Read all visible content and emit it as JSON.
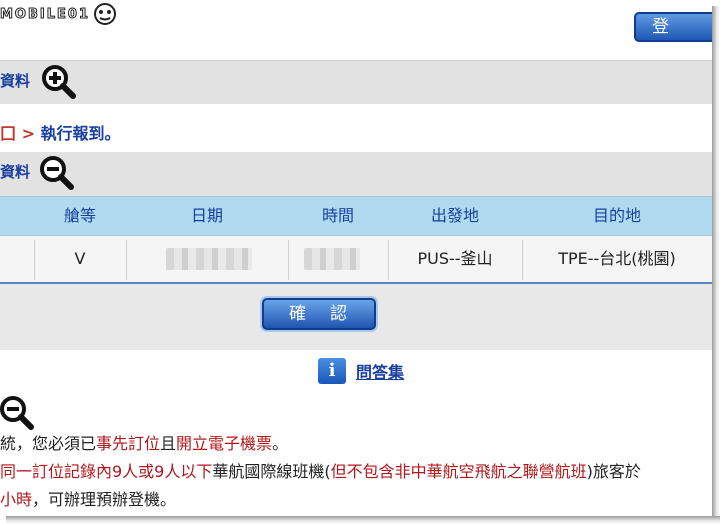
{
  "header": {
    "logo_text": "MOBILE01",
    "login_label": "登"
  },
  "section1": {
    "label": "資料",
    "icon": "zoom-in-icon"
  },
  "instruction": {
    "arrow": "囗 >",
    "text": " 執行報到。"
  },
  "section2": {
    "label": "資料",
    "icon": "zoom-out-icon"
  },
  "table": {
    "headers": [
      "艙等",
      "日期",
      "時間",
      "出發地",
      "目的地"
    ],
    "row": {
      "cabin": "V",
      "date": "",
      "time": "",
      "origin": "PUS--釜山",
      "destination": "TPE--台北(桃園)"
    }
  },
  "confirm": {
    "label": "確認"
  },
  "faq": {
    "icon_char": "i",
    "label": "問答集"
  },
  "notes": {
    "line1": [
      {
        "text": "統，您必須已",
        "style": "normal"
      },
      {
        "text": "事先訂位",
        "style": "red"
      },
      {
        "text": "且",
        "style": "normal"
      },
      {
        "text": "開立電子機票",
        "style": "red"
      },
      {
        "text": "。",
        "style": "normal"
      }
    ],
    "line2": [
      {
        "text": "同一訂位記錄內9人或9人以下",
        "style": "red"
      },
      {
        "text": "華航國際線班機(",
        "style": "normal"
      },
      {
        "text": "但不包含非中華航空飛航之聯營航班",
        "style": "red"
      },
      {
        "text": ")旅客於",
        "style": "normal"
      }
    ],
    "line3": [
      {
        "text": "小時",
        "style": "red"
      },
      {
        "text": "，可辦理預辦登機。",
        "style": "normal"
      }
    ]
  },
  "colors": {
    "header_bg": "#b0daf0",
    "link_blue": "#1a3f9e",
    "accent_red": "#b0181c",
    "button_blue": "#1e55b0"
  }
}
